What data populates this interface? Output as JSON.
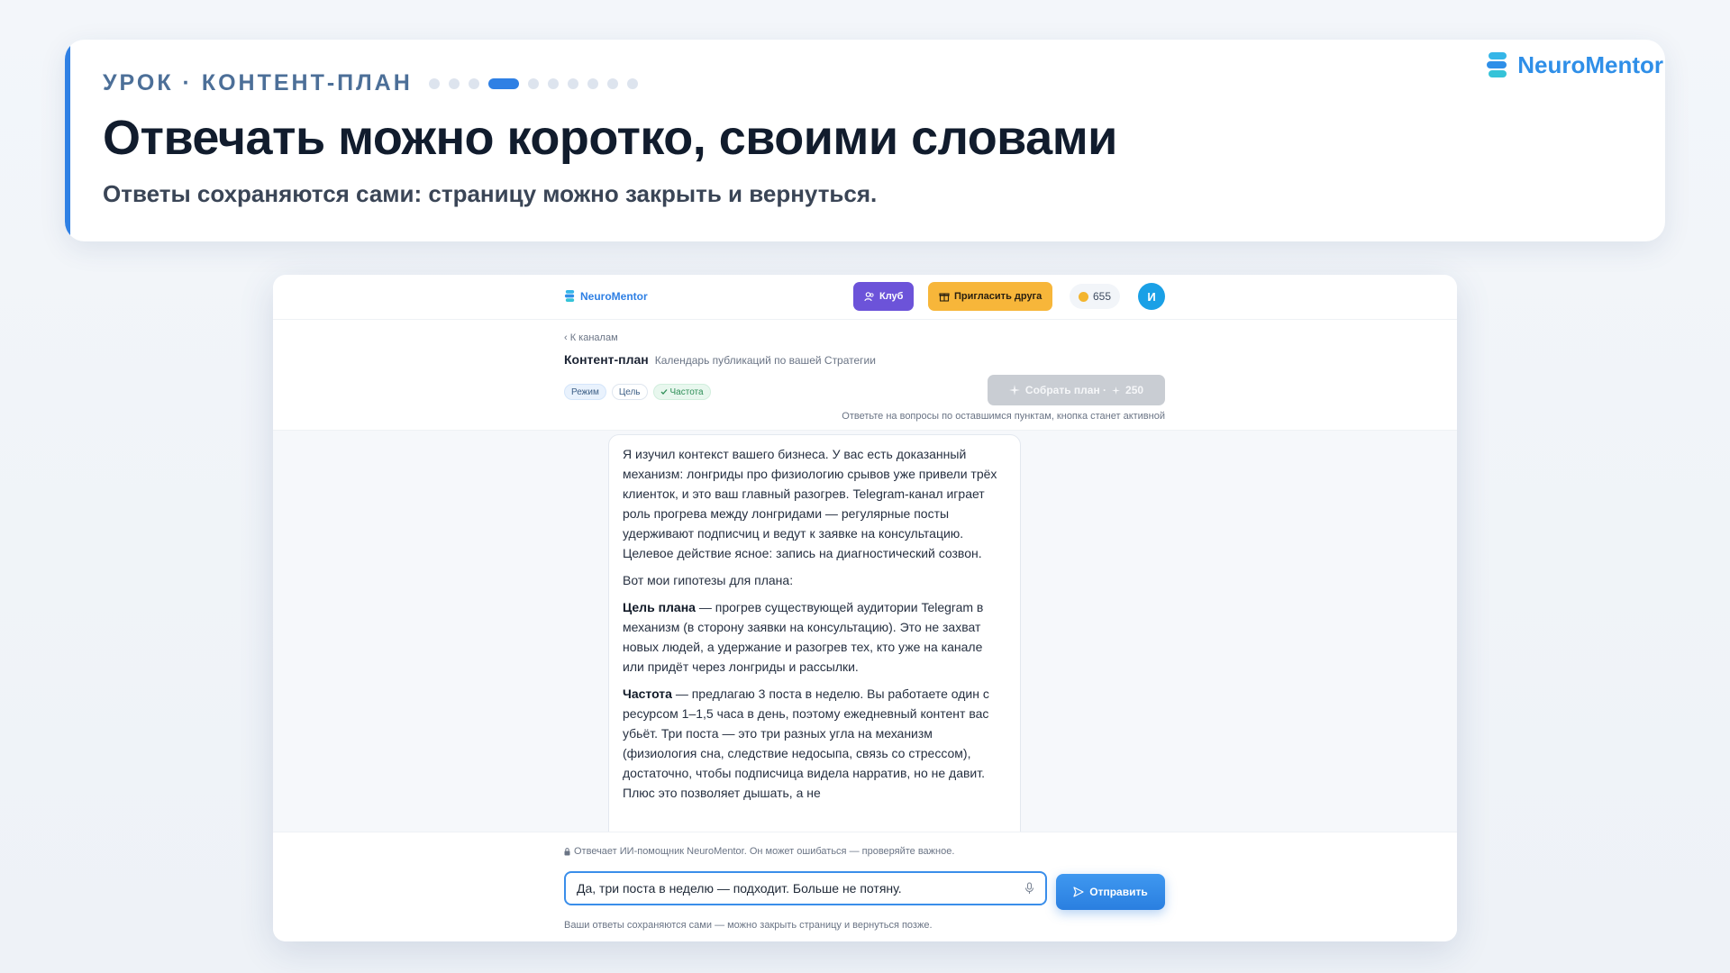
{
  "lesson": {
    "eyebrow": "УРОК · КОНТЕНТ-ПЛАН",
    "progress": {
      "total": 10,
      "current": 4
    },
    "title": "Отвечать можно коротко, своими словами",
    "subtitle": "Ответы сохраняются сами: страницу можно закрыть и вернуться.",
    "brand": "NeuroMentor"
  },
  "app": {
    "brand": "NeuroMentor",
    "header": {
      "club_label": "Клуб",
      "invite_label": "Пригласить друга",
      "coins": "655",
      "avatar_initial": "И"
    },
    "page": {
      "back_label": "‹ К каналам",
      "title": "Контент-план",
      "description": "Календарь публикаций по вашей Стратегии",
      "chips": [
        {
          "label": "Режим"
        },
        {
          "label": "Цель"
        },
        {
          "label": "Частота"
        }
      ],
      "build_button": {
        "label": "Собрать план ·",
        "cost": "250"
      },
      "build_hint": "Ответьте на вопросы по оставшимся пунктам, кнопка станет активной"
    },
    "message": {
      "p1": "Я изучил контекст вашего бизнеса. У вас есть доказанный механизм: лонгриды про физиологию срывов уже привели трёх клиенток, и это ваш главный разогрев. Telegram-канал играет роль прогрева между лонгридами — регулярные посты удерживают подписчиц и ведут к заявке на консультацию. Целевое действие ясное: запись на диагностический созвон.",
      "p2": "Вот мои гипотезы для плана:",
      "p3_bold": "Цель плана",
      "p3": " — прогрев существующей аудитории Telegram в механизм (в сторону заявки на консультацию). Это не захват новых людей, а удержание и разогрев тех, кто уже на канале или придёт через лонгриды и рассылки.",
      "p4_bold": "Частота",
      "p4": " — предлагаю 3 поста в неделю. Вы работаете один с ресурсом 1–1,5 часа в день, поэтому ежедневный контент вас убьёт. Три поста — это три разных угла на механизм (физиология сна, следствие недосыпа, связь со стрессом), достаточно, чтобы подписчица видела нарратив, но не давит. Плюс это позволяет дышать, а не"
    },
    "composer": {
      "ai_note": "Отвечает ИИ-помощник NeuroMentor. Он может ошибаться — проверяйте важное.",
      "input_value": "Да, три поста в неделю — подходит. Больше не потяну.",
      "send_label": "Отправить",
      "save_note": "Ваши ответы сохраняются сами — можно закрыть страницу и вернуться позже."
    }
  },
  "colors": {
    "accent": "#2f80e4",
    "club": "#6c53d9",
    "invite": "#f7b63a",
    "avatar": "#1aa0e6"
  },
  "icons": [
    "neuromentor-logo-icon",
    "users-icon",
    "gift-icon",
    "coin-icon",
    "sparkle-icon",
    "check-icon",
    "microphone-icon",
    "send-icon",
    "chat-bot-icon",
    "lock-icon"
  ]
}
